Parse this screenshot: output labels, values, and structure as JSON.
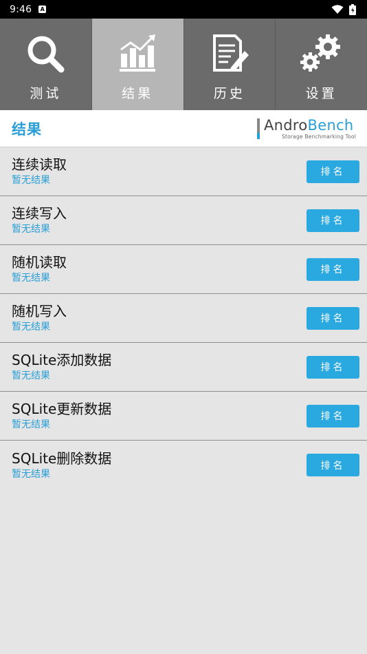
{
  "status_bar": {
    "time": "9:46"
  },
  "tabs": [
    {
      "label": "测试",
      "icon": "search-icon",
      "active": false
    },
    {
      "label": "结果",
      "icon": "chart-icon",
      "active": true
    },
    {
      "label": "历史",
      "icon": "history-icon",
      "active": false
    },
    {
      "label": "设置",
      "icon": "gear-icon",
      "active": false
    }
  ],
  "header": {
    "title": "结果",
    "brand_part1": "Andro",
    "brand_part2": "Bench",
    "brand_subtitle": "Storage Benchmarking Tool"
  },
  "results": [
    {
      "title": "连续读取",
      "status": "暂无结果",
      "button": "排名"
    },
    {
      "title": "连续写入",
      "status": "暂无结果",
      "button": "排名"
    },
    {
      "title": "随机读取",
      "status": "暂无结果",
      "button": "排名"
    },
    {
      "title": "随机写入",
      "status": "暂无结果",
      "button": "排名"
    },
    {
      "title": "SQLite添加数据",
      "status": "暂无结果",
      "button": "排名"
    },
    {
      "title": "SQLite更新数据",
      "status": "暂无结果",
      "button": "排名"
    },
    {
      "title": "SQLite删除数据",
      "status": "暂无结果",
      "button": "排名"
    }
  ],
  "colors": {
    "accent": "#2a9fd6",
    "tab_bg": "#6b6b6b",
    "tab_active": "#b6b6b6"
  }
}
